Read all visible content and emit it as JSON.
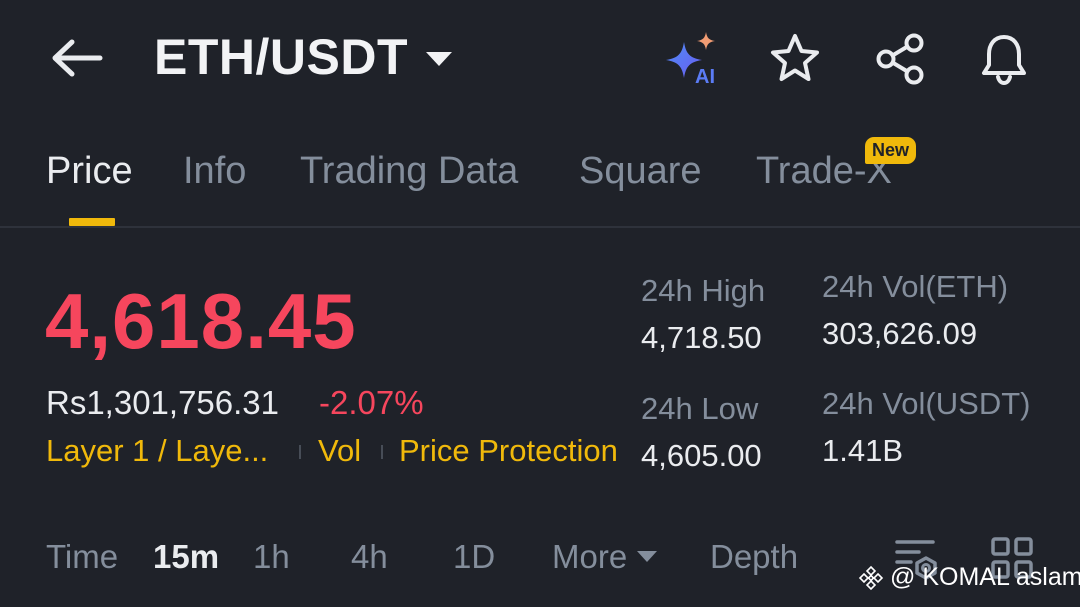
{
  "header": {
    "pair": "ETH/USDT",
    "icons": [
      "back-arrow-icon",
      "ai-sparkle-icon",
      "star-icon",
      "share-icon",
      "bell-icon"
    ],
    "ai_label": "AI"
  },
  "tabs": {
    "items": [
      {
        "label": "Price",
        "active": true
      },
      {
        "label": "Info"
      },
      {
        "label": "Trading Data"
      },
      {
        "label": "Square"
      },
      {
        "label": "Trade-X"
      }
    ],
    "new_badge": "New"
  },
  "price": {
    "last": "4,618.45",
    "fiat": "Rs1,301,756.31",
    "change": "-2.07%"
  },
  "tags": {
    "layer": "Layer 1 / Laye...",
    "vol": "Vol",
    "protection": "Price Protection"
  },
  "stats": {
    "high_label": "24h High",
    "high_value": "4,718.50",
    "low_label": "24h Low",
    "low_value": "4,605.00",
    "vol_eth_label": "24h Vol(ETH)",
    "vol_eth_value": "303,626.09",
    "vol_usdt_label": "24h Vol(USDT)",
    "vol_usdt_value": "1.41B"
  },
  "intervals": {
    "items": [
      "Time",
      "15m",
      "1h",
      "4h",
      "1D",
      "More",
      "Depth"
    ],
    "active": "15m"
  },
  "watermark": "@ KOMAL aslam",
  "colors": {
    "background": "#1f2229",
    "down": "#f6465d",
    "accent": "#f0b90b",
    "muted": "#848e9c"
  }
}
